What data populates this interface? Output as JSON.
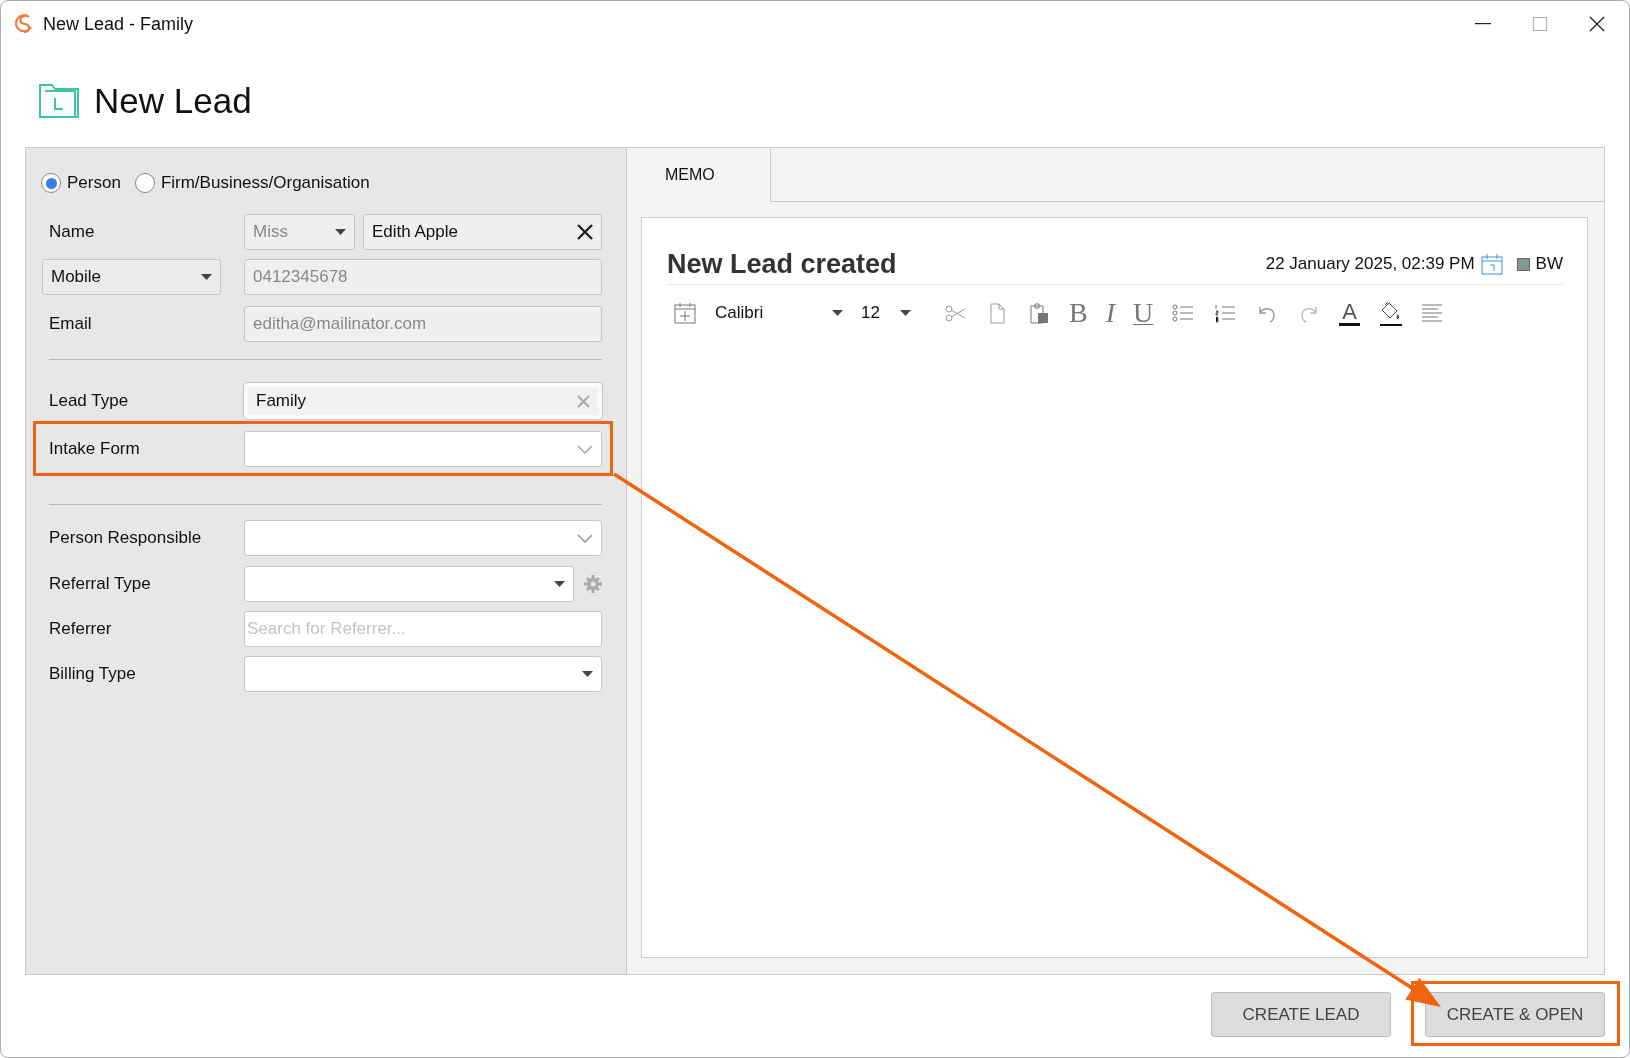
{
  "window": {
    "title": "New Lead - Family"
  },
  "header": {
    "title": "New Lead"
  },
  "contact_types": [
    {
      "label": "Person",
      "selected": true
    },
    {
      "label": "Firm/Business/Organisation",
      "selected": false
    }
  ],
  "name": {
    "label": "Name",
    "title": "Miss",
    "value": "Edith Apple"
  },
  "phone": {
    "type": "Mobile",
    "value": "0412345678"
  },
  "email": {
    "label": "Email",
    "value": "editha@mailinator.com"
  },
  "lead_type": {
    "label": "Lead Type",
    "value": "Family"
  },
  "intake_form": {
    "label": "Intake Form",
    "highlighted": true
  },
  "person_responsible": {
    "label": "Person Responsible"
  },
  "referral_type": {
    "label": "Referral Type"
  },
  "referrer": {
    "label": "Referrer",
    "placeholder": "Search for Referrer..."
  },
  "billing_type": {
    "label": "Billing Type"
  },
  "memo": {
    "tab": "MEMO",
    "title": "New Lead created",
    "timestamp": "22 January 2025, 02:39 PM",
    "author": "BW",
    "toolbar": [
      {
        "kind": "insert-date"
      },
      {
        "kind": "font",
        "value": "Calibri"
      },
      {
        "kind": "size",
        "value": "12"
      },
      {
        "kind": "cut"
      },
      {
        "kind": "copy"
      },
      {
        "kind": "paste"
      },
      {
        "kind": "bold",
        "glyph": "B"
      },
      {
        "kind": "italic",
        "glyph": "I"
      },
      {
        "kind": "underline",
        "glyph": "U"
      },
      {
        "kind": "bullets"
      },
      {
        "kind": "numbering"
      },
      {
        "kind": "undo"
      },
      {
        "kind": "redo"
      },
      {
        "kind": "font-color",
        "glyph": "A"
      },
      {
        "kind": "fill"
      },
      {
        "kind": "align"
      }
    ]
  },
  "buttons": [
    {
      "label": "CREATE LEAD",
      "highlighted": false
    },
    {
      "label": "CREATE & OPEN",
      "highlighted": true
    }
  ]
}
